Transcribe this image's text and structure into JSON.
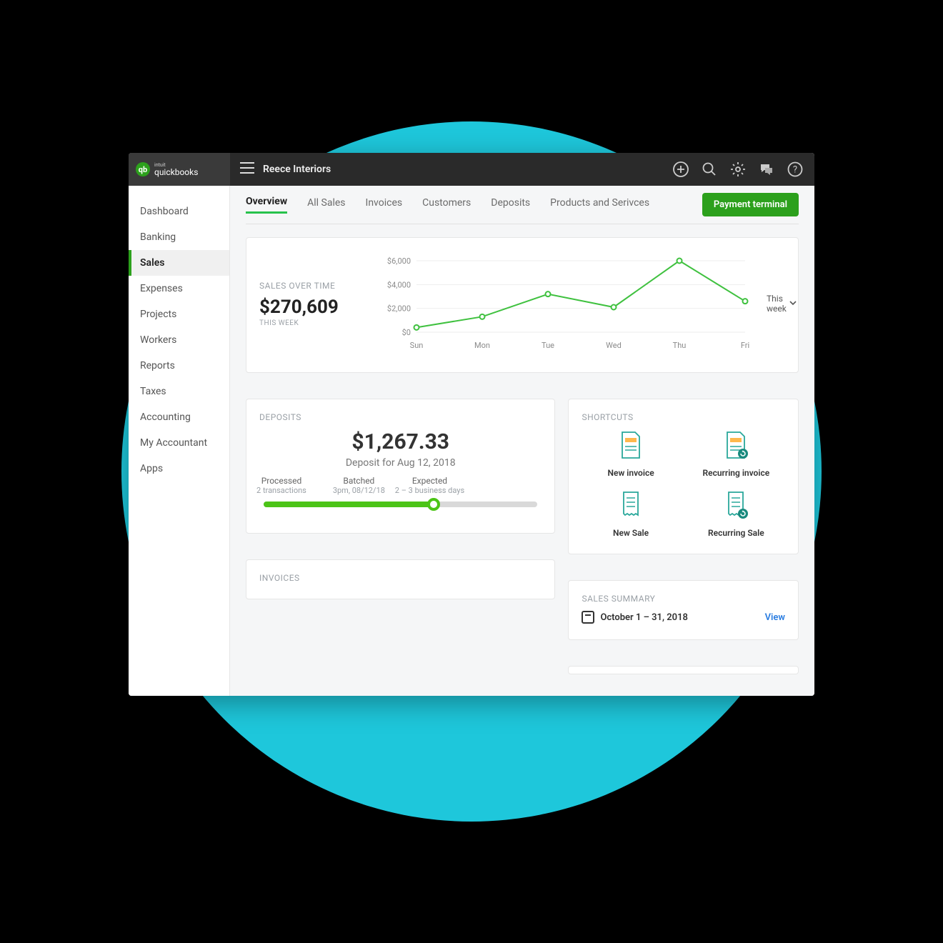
{
  "brand_name": "quickbooks",
  "brand_parent": "intuit",
  "company_name": "Reece Interiors",
  "sidebar": {
    "items": [
      {
        "label": "Dashboard",
        "active": false
      },
      {
        "label": "Banking",
        "active": false
      },
      {
        "label": "Sales",
        "active": true
      },
      {
        "label": "Expenses",
        "active": false
      },
      {
        "label": "Projects",
        "active": false
      },
      {
        "label": "Workers",
        "active": false
      },
      {
        "label": "Reports",
        "active": false
      },
      {
        "label": "Taxes",
        "active": false
      },
      {
        "label": "Accounting",
        "active": false
      },
      {
        "label": "My Accountant",
        "active": false
      },
      {
        "label": "Apps",
        "active": false
      }
    ]
  },
  "tabs": {
    "items": [
      {
        "label": "Overview",
        "active": true
      },
      {
        "label": "All Sales"
      },
      {
        "label": "Invoices"
      },
      {
        "label": "Customers"
      },
      {
        "label": "Deposits"
      },
      {
        "label": "Products and Serivces"
      }
    ],
    "cta": "Payment terminal"
  },
  "sales_over_time": {
    "title": "SALES OVER TIME",
    "amount": "$270,609",
    "period": "THIS WEEK",
    "range_selector": "This week"
  },
  "chart_data": {
    "type": "line",
    "title": "SALES OVER TIME",
    "xlabel": "",
    "ylabel": "",
    "categories": [
      "Sun",
      "Mon",
      "Tue",
      "Wed",
      "Thu",
      "Fri"
    ],
    "values": [
      400,
      1300,
      3200,
      2100,
      6000,
      2600
    ],
    "ylim": [
      0,
      6000
    ],
    "y_ticks": [
      "$0",
      "$2,000",
      "$4,000",
      "$6,000"
    ]
  },
  "deposits": {
    "title": "DEPOSITS",
    "amount": "$1,267.33",
    "subtitle": "Deposit for Aug 12, 2018",
    "steps": {
      "processed": {
        "label": "Processed",
        "sub": "2 transactions"
      },
      "batched": {
        "label": "Batched",
        "sub": "3pm, 08/12/18"
      },
      "expected": {
        "label": "Expected",
        "sub": "2 – 3 business days"
      }
    }
  },
  "shortcuts": {
    "title": "SHORTCUTS",
    "items": [
      {
        "label": "New invoice"
      },
      {
        "label": "Recurring invoice"
      },
      {
        "label": "New Sale"
      },
      {
        "label": "Recurring Sale"
      }
    ]
  },
  "sales_summary": {
    "title": "SALES SUMMARY",
    "date": "October 1 – 31, 2018",
    "view": "View"
  },
  "invoices": {
    "title": "INVOICES"
  }
}
